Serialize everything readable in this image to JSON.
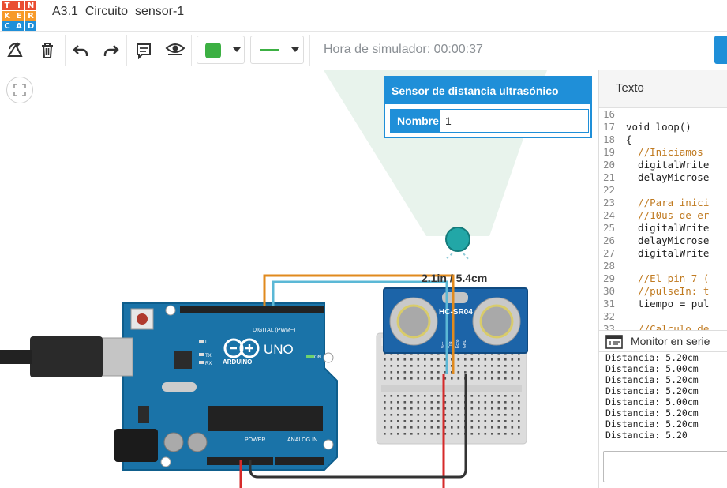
{
  "app": {
    "logo_letters": [
      "T",
      "I",
      "N",
      "K",
      "E",
      "R",
      "C",
      "A",
      "D"
    ],
    "logo_colors": [
      "#e94e32",
      "#e94e32",
      "#e94e32",
      "#f79a2a",
      "#f79a2a",
      "#f79a2a",
      "#1f8fd8",
      "#1f8fd8",
      "#1f8fd8"
    ],
    "project_title": "A3.1_Circuito_sensor-1"
  },
  "toolbar": {
    "rotate_icon": "rotate-icon",
    "delete_icon": "trash-icon",
    "undo_icon": "undo-icon",
    "redo_icon": "redo-icon",
    "notes_icon": "notes-icon",
    "visibility_icon": "eye-icon",
    "fill_color": "#3cb043",
    "line_color": "#3cb043",
    "sim_time": "Hora de simulador: 00:00:37"
  },
  "canvas": {
    "distance_label": "2.1in / 5.4cm",
    "sensor_model": "HC-SR04",
    "sensor_pins": [
      "Vcc",
      "Trig",
      "Echo",
      "GND"
    ],
    "board_name": "UNO",
    "board_brand": "ARDUINO",
    "digital_label": "DIGITAL (PWM~)",
    "power_label": "POWER",
    "analog_label": "ANALOG IN",
    "on_label": "ON",
    "tx_label": "TX",
    "rx_label": "RX",
    "l_label": "L",
    "wire_colors": {
      "trig": "#e08a1e",
      "echo": "#5bb8d6",
      "vcc": "#d62a2a",
      "gnd": "#333333"
    }
  },
  "property_panel": {
    "title": "Sensor de distancia ultrasónico",
    "name_label": "Nombre",
    "name_value": "1"
  },
  "code_panel": {
    "tab_label": "Texto",
    "lines": [
      {
        "num": "16",
        "text": "",
        "comment": false
      },
      {
        "num": "17",
        "text": "void loop()",
        "comment": false
      },
      {
        "num": "18",
        "text": "{",
        "comment": false
      },
      {
        "num": "19",
        "text": "  //Iniciamos",
        "comment": true
      },
      {
        "num": "20",
        "text": "  digitalWrite",
        "comment": false
      },
      {
        "num": "21",
        "text": "  delayMicrose",
        "comment": false
      },
      {
        "num": "22",
        "text": "",
        "comment": false
      },
      {
        "num": "23",
        "text": "  //Para inici",
        "comment": true
      },
      {
        "num": "24",
        "text": "  //10us de er",
        "comment": true
      },
      {
        "num": "25",
        "text": "  digitalWrite",
        "comment": false
      },
      {
        "num": "26",
        "text": "  delayMicrose",
        "comment": false
      },
      {
        "num": "27",
        "text": "  digitalWrite",
        "comment": false
      },
      {
        "num": "28",
        "text": "",
        "comment": false
      },
      {
        "num": "29",
        "text": "  //El pin 7 (",
        "comment": true
      },
      {
        "num": "30",
        "text": "  //pulseIn: t",
        "comment": true
      },
      {
        "num": "31",
        "text": "  tiempo = pul",
        "comment": false
      },
      {
        "num": "32",
        "text": "",
        "comment": false
      },
      {
        "num": "33",
        "text": "  //Calculo de",
        "comment": true
      }
    ]
  },
  "serial": {
    "title": "Monitor en serie",
    "icon": "monitor-icon",
    "lines": [
      "Distancia: 5.20cm",
      "Distancia: 5.00cm",
      "Distancia: 5.20cm",
      "Distancia: 5.20cm",
      "Distancia: 5.00cm",
      "Distancia: 5.20cm",
      "Distancia: 5.20cm",
      "Distancia: 5.20"
    ]
  }
}
